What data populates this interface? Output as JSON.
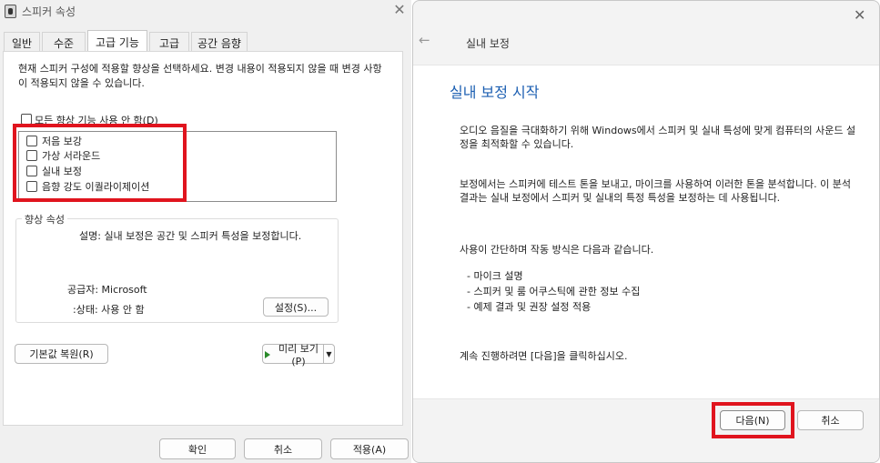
{
  "left_dialog": {
    "title": "스피커 속성",
    "close_glyph": "✕",
    "tabs": [
      {
        "label": "일반"
      },
      {
        "label": "수준"
      },
      {
        "label": "고급 기능"
      },
      {
        "label": "고급"
      },
      {
        "label": "공간 음향"
      }
    ],
    "description": "현재 스피커 구성에 적용할 향상을 선택하세요. 변경 내용이 적용되지 않을 때 변경 사항이 적용되지 않을 수 있습니다.",
    "disable_all_label": "모든 향상 기능 사용 안 함(D)",
    "enhancements": [
      {
        "label": "저음 보강",
        "checked": false
      },
      {
        "label": "가상 서라운드",
        "checked": false
      },
      {
        "label": "실내 보정",
        "checked": false
      },
      {
        "label": "음향 강도 이퀄라이제이션",
        "checked": false
      }
    ],
    "properties": {
      "group_title": "향상 속성",
      "description": "설명: 실내 보정은 공간 및 스피커 특성을 보정합니다.",
      "provider": "공급자: Microsoft",
      "status": ":상태: 사용 안 함",
      "settings_button": "설정(S)..."
    },
    "restore_defaults_button": "기본값 복원(R)",
    "preview_button": "미리 보기(P)",
    "preview_dropdown_glyph": "▼",
    "footer": {
      "ok": "확인",
      "cancel": "취소",
      "apply": "적용(A)"
    },
    "highlight_color": "#e0141e"
  },
  "right_wizard": {
    "close_glyph": "✕",
    "back_glyph": "←",
    "header": "실내 보정",
    "title": "실내 보정 시작",
    "paragraph1": "오디오 음질을 극대화하기 위해 Windows에서 스피커 및 실내 특성에 맞게 컴퓨터의 사운드 설정을 최적화할 수 있습니다.",
    "paragraph2": "보정에서는 스피커에 테스트 톤을 보내고, 마이크를 사용하여 이러한 톤을 분석합니다. 이 분석 결과는 실내 보정에서 스피커 및 실내의 특정 특성을 보정하는 데 사용됩니다.",
    "paragraph3": "사용이 간단하며 작동 방식은 다음과 같습니다.",
    "bullets": [
      "- 마이크 설명",
      "- 스피커 및 룸 어쿠스틱에 관한 정보 수집",
      "- 예제 결과 및 권장 설정 적용"
    ],
    "paragraph4": "계속 진행하려면 [다음]을 클릭하십시오.",
    "next_button": "다음(N)",
    "cancel_button": "취소",
    "title_color": "#1c5fb2"
  }
}
